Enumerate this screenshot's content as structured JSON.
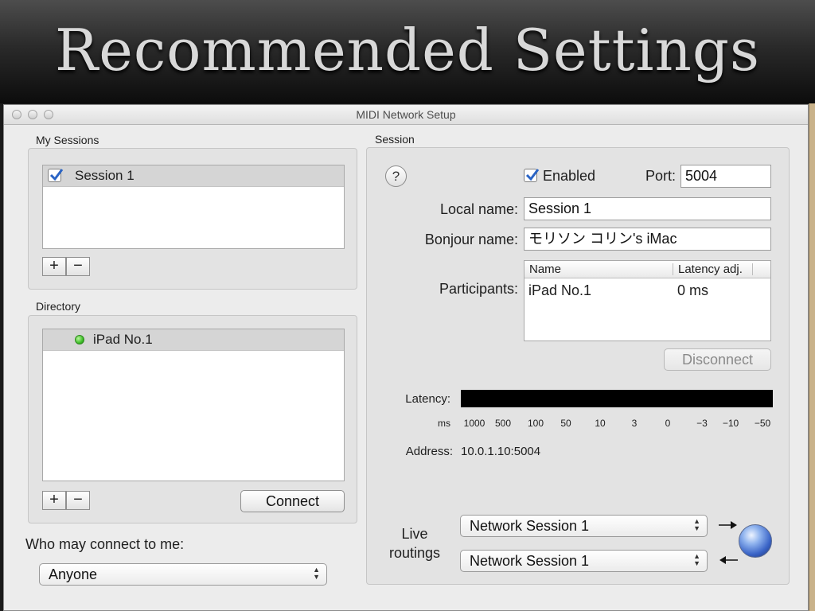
{
  "slide": {
    "title": "Recommended Settings"
  },
  "window": {
    "title": "MIDI Network Setup"
  },
  "my_sessions": {
    "header": "My Sessions",
    "items": [
      {
        "label": "Session 1",
        "checked": true
      }
    ],
    "add_label": "+",
    "remove_label": "−"
  },
  "directory": {
    "header": "Directory",
    "items": [
      {
        "label": "iPad No.1",
        "status_color": "#3fbf2a"
      }
    ],
    "add_label": "+",
    "remove_label": "−",
    "connect_label": "Connect"
  },
  "who_may_connect": {
    "label": "Who may connect to me:",
    "value": "Anyone"
  },
  "session": {
    "header": "Session",
    "help_label": "?",
    "enabled_label": "Enabled",
    "enabled": true,
    "port_label": "Port:",
    "port_value": "5004",
    "local_name_label": "Local name:",
    "local_name_value": "Session 1",
    "bonjour_name_label": "Bonjour name:",
    "bonjour_name_value": "モリソン コリン's iMac",
    "participants_label": "Participants:",
    "participants_columns": [
      "Name",
      "Latency adj."
    ],
    "participants_rows": [
      {
        "name": "iPad No.1",
        "latency": "0 ms"
      }
    ],
    "disconnect_label": "Disconnect",
    "latency_label": "Latency:",
    "latency_unit": "ms",
    "latency_scale": [
      "1000",
      "500",
      "100",
      "50",
      "10",
      "3",
      "0",
      "−3",
      "−10",
      "−50"
    ],
    "address_label": "Address:",
    "address_value": "10.0.1.10:5004",
    "live_routings_label": [
      "Live",
      "routings"
    ],
    "routing_in_value": "Network Session 1",
    "routing_out_value": "Network Session 1"
  },
  "colors": {
    "accent_check": "#2a64c5",
    "latency_bar": "#000000"
  }
}
